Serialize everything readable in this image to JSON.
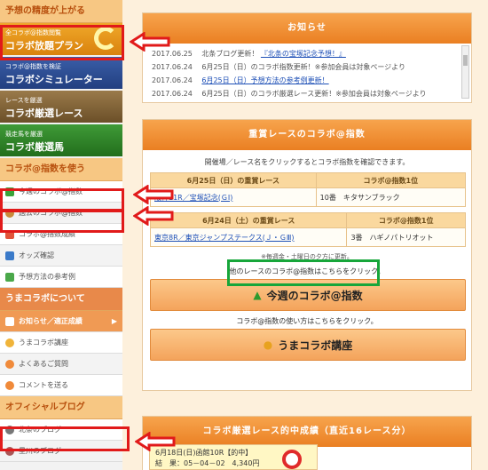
{
  "sidebar": {
    "head_accuracy": "予想の精度が上がる",
    "banners": [
      {
        "small": "全コラボ@指数閲覧",
        "big": "コラボ放題プラン"
      },
      {
        "small": "コラボ@指数を検証",
        "big": "コラボシミュレーター"
      },
      {
        "small": "レースを厳選",
        "big": "コラボ厳選レース"
      },
      {
        "small": "競走馬を厳選",
        "big": "コラボ厳選馬"
      }
    ],
    "head_use": "コラボ@指数を使う",
    "use_items": [
      "今週のコラボ@指数",
      "過去のコラボ@指数",
      "コラボ@指数成績",
      "オッズ確認",
      "予想方法の参考例"
    ],
    "head_about": "うまコラボについて",
    "about_items": [
      "お知らせ／適正成績",
      "うまコラボ講座",
      "よくあるご質問",
      "コメントを送る"
    ],
    "head_blog": "オフィシャルブログ",
    "blog_items": [
      "北条のブログ",
      "星川のブログ"
    ]
  },
  "news": {
    "title": "お知らせ",
    "rows": [
      {
        "date": "",
        "text": "",
        "link": "北条ブログ更新！『北条の宝塚記念予想！』"
      },
      {
        "date": "2017.06.25",
        "text": "北条ブログ更新！",
        "link": "『北条の宝塚記念予想！』"
      },
      {
        "date": "2017.06.24",
        "text": "6月25日（日）のコラボ指数更新！※参加会員は対象ページより",
        "link": ""
      },
      {
        "date": "2017.06.24",
        "text": "",
        "link": "6月25日（日）予想方法の参考例更新！"
      },
      {
        "date": "2017.06.24",
        "text": "6月25日（日）のコラボ厳選レース更新！※参加会員は対象ページより",
        "link": ""
      }
    ]
  },
  "index": {
    "title": "重賞レースのコラボ@指数",
    "intro": "開催場／レース名をクリックするとコラボ指数を確認できます。",
    "tables": [
      {
        "head_race": "6月25日（日）の重賞レース",
        "head_rank": "コラボ@指数1位",
        "race": "阪神11R／宝塚記念(ＧⅠ)",
        "rank": "10番　キタサンブラック"
      },
      {
        "head_race": "6月24日（土）の重賞レース",
        "head_rank": "コラボ@指数1位",
        "race": "東京8R／東京ジャンプステークス(Ｊ・ＧⅢ)",
        "rank": "3番　ハギノパトリオット"
      }
    ],
    "note": "※毎週金・土曜日の夕方に更新。",
    "cta1_caption": "他のレースのコラボ@指数はこちらをクリック。",
    "cta1_label": "今週のコラボ@指数",
    "cta2_caption": "コラボ@指数の使い方はこちらをクリック。",
    "cta2_label": "うまコラボ講座"
  },
  "results": {
    "title": "コラボ厳選レース的中成績（直近16レース分）",
    "line1": "6月18日(日)函館10R【的中】",
    "line2": "結　果：05－04－02　4,340円"
  },
  "colors": {
    "accent": "#ea7f22",
    "highlight": "#e11a1a",
    "note_box": "#17a63a"
  }
}
